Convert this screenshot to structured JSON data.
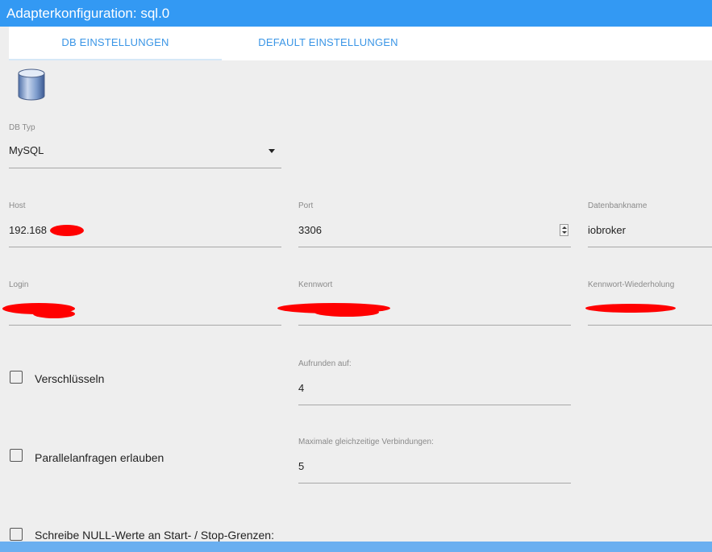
{
  "window": {
    "title": "Adapterkonfiguration: sql.0"
  },
  "tabs": [
    {
      "label": "DB EINSTELLUNGEN",
      "active": true
    },
    {
      "label": "DEFAULT EINSTELLUNGEN",
      "active": false
    }
  ],
  "icons": {
    "database": "database-icon"
  },
  "fields": {
    "db_type": {
      "label": "DB Typ",
      "value": "MySQL"
    },
    "host": {
      "label": "Host",
      "value": "192.168"
    },
    "port": {
      "label": "Port",
      "value": "3306"
    },
    "db_name": {
      "label": "Datenbankname",
      "value": "iobroker"
    },
    "login": {
      "label": "Login",
      "value": ""
    },
    "password": {
      "label": "Kennwort",
      "value": ""
    },
    "password_repeat": {
      "label": "Kennwort-Wiederholung",
      "value": ""
    },
    "round": {
      "label": "Aufrunden auf:",
      "value": "4"
    },
    "max_conn": {
      "label": "Maximale gleichzeitige Verbindungen:",
      "value": "5"
    }
  },
  "checkboxes": {
    "encrypt": {
      "label": "Verschlüsseln",
      "checked": false
    },
    "parallel": {
      "label": "Parallelanfragen erlauben",
      "checked": false
    },
    "null_values": {
      "label": "Schreibe NULL-Werte an Start- / Stop-Grenzen:",
      "checked": false
    }
  },
  "colors": {
    "titlebar": "#3399f3",
    "tab_text": "#3b96e6",
    "redaction": "#ff0000"
  }
}
